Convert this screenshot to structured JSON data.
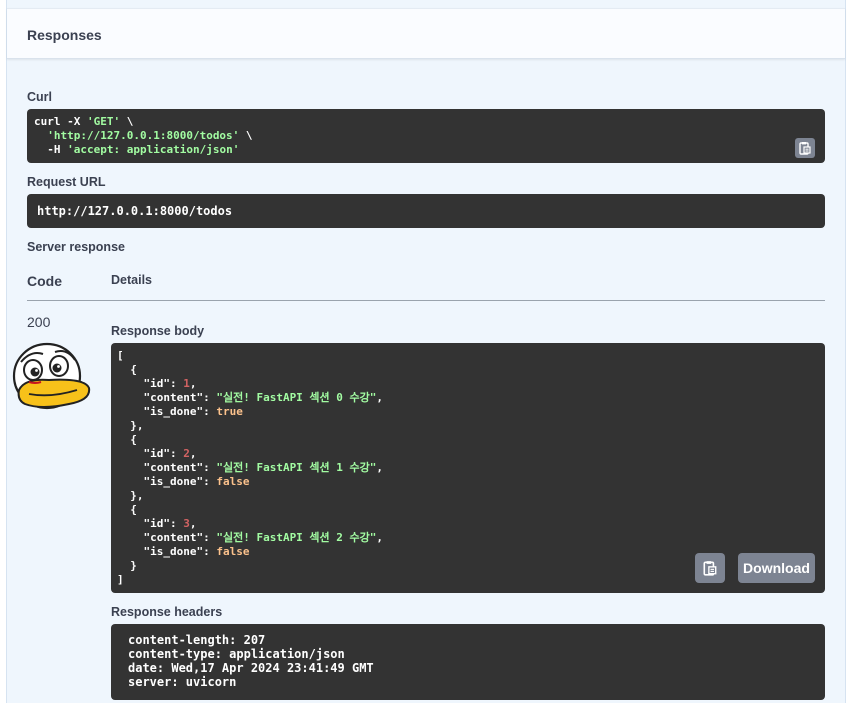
{
  "responses": {
    "title": "Responses"
  },
  "curl": {
    "label": "Curl",
    "line1_cmd": "curl -X ",
    "line1_method": "'GET'",
    "line1_tail": " \\",
    "line2_indent": "  ",
    "line2_url": "'http://127.0.0.1:8000/todos'",
    "line2_tail": " \\",
    "line3_flag": "  -H ",
    "line3_header": "'accept: application/json'"
  },
  "request_url": {
    "label": "Request URL",
    "value": "http://127.0.0.1:8000/todos"
  },
  "server_response": {
    "label": "Server response",
    "col_code": "Code",
    "col_details": "Details",
    "status_code": "200"
  },
  "response_body": {
    "label": "Response body",
    "items": [
      {
        "id": "1",
        "content": "\"실전! FastAPI 섹션 0 수강\"",
        "is_done": "true"
      },
      {
        "id": "2",
        "content": "\"실전! FastAPI 섹션 1 수강\"",
        "is_done": "false"
      },
      {
        "id": "3",
        "content": "\"실전! FastAPI 섹션 2 수강\"",
        "is_done": "false"
      }
    ],
    "download_label": "Download"
  },
  "response_headers": {
    "label": "Response headers",
    "lines": [
      "content-length: 207",
      "content-type: application/json",
      "date: Wed,17 Apr 2024 23:41:49 GMT",
      "server: uvicorn"
    ]
  },
  "icons": {
    "copy": "clipboard-copy-icon",
    "avatar": "duck-avatar-icon"
  },
  "colors": {
    "code_bg": "#333333",
    "string": "#a2fca2",
    "number": "#d36363",
    "boolean": "#fcc28c",
    "button": "#7d8492",
    "panel": "#eff6fd"
  }
}
